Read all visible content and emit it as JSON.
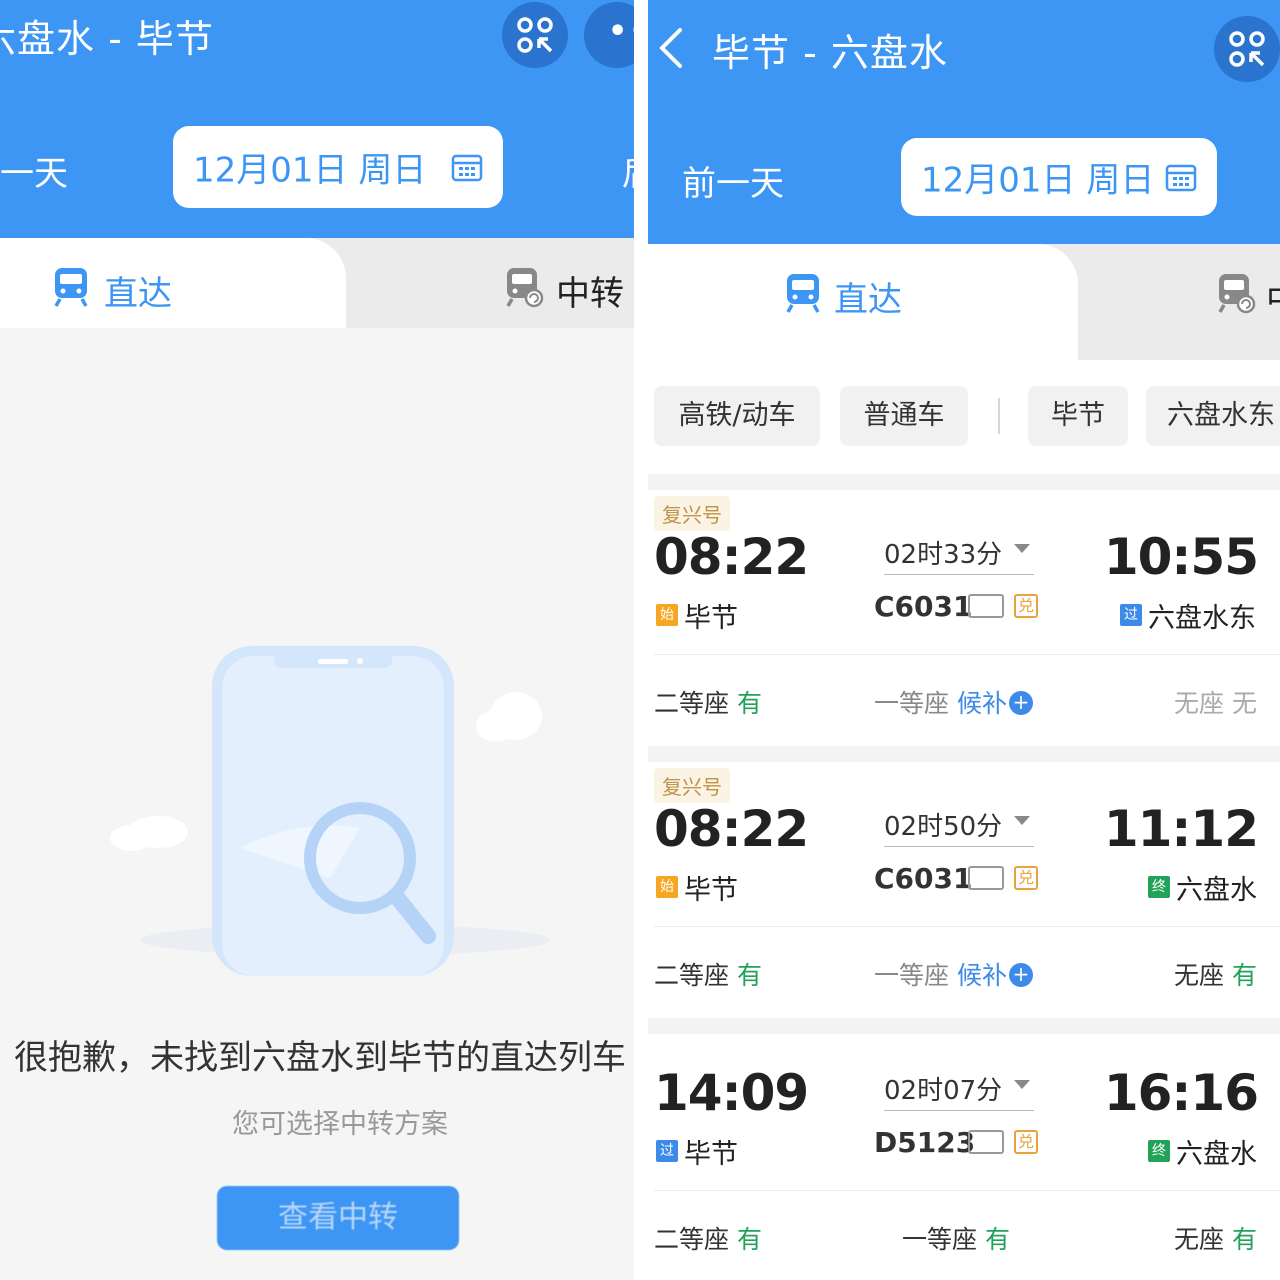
{
  "left": {
    "header_title": "六盘水 - 毕节",
    "prev_day": "前一天",
    "next_day": "后一天",
    "date": "12月01日  周日",
    "tab_direct": "直达",
    "tab_transfer": "中转",
    "empty_message": "很抱歉，未找到六盘水到毕节的直达列车",
    "empty_sub": "您可选择中转方案",
    "empty_button": "查看中转"
  },
  "right": {
    "header_title": "毕节 - 六盘水",
    "prev_day": "前一天",
    "date": "12月01日  周日",
    "tab_direct": "直达",
    "tab_transfer": "中转",
    "filters": [
      "高铁/动车",
      "普通车",
      "毕节",
      "六盘水东"
    ],
    "trains": [
      {
        "tag": "复兴号",
        "dep_time": "08:22",
        "duration": "02时33分",
        "train_no": "C6031",
        "dui": "兑",
        "arr_time": "10:55",
        "from_badge": "始",
        "from": "毕节",
        "to_badge": "过",
        "to": "六盘水东",
        "seats": [
          {
            "name": "二等座",
            "status": "有"
          },
          {
            "name": "一等座",
            "status": "候补"
          },
          {
            "name": "无座",
            "status": "无"
          }
        ]
      },
      {
        "tag": "复兴号",
        "dep_time": "08:22",
        "duration": "02时50分",
        "train_no": "C6031",
        "dui": "兑",
        "arr_time": "11:12",
        "from_badge": "始",
        "from": "毕节",
        "to_badge": "终",
        "to": "六盘水",
        "seats": [
          {
            "name": "二等座",
            "status": "有"
          },
          {
            "name": "一等座",
            "status": "候补"
          },
          {
            "name": "无座",
            "status": "有"
          }
        ]
      },
      {
        "tag": "",
        "dep_time": "14:09",
        "duration": "02时07分",
        "train_no": "D5123",
        "dui": "兑",
        "arr_time": "16:16",
        "from_badge": "过",
        "from": "毕节",
        "to_badge": "终",
        "to": "六盘水",
        "seats": [
          {
            "name": "二等座",
            "status": "有"
          },
          {
            "name": "一等座",
            "status": "有"
          },
          {
            "name": "无座",
            "status": "有"
          }
        ]
      }
    ]
  },
  "colors": {
    "header_blue": "#3d96f3",
    "available_green": "#23a35a",
    "waitlist_blue": "#3d8ae8",
    "origin_orange": "#f5a623",
    "pass_blue": "#3d8ae8",
    "terminal_green": "#23a35a"
  },
  "icons": {
    "app_button": "share-grid-icon",
    "more": "more-dots-icon",
    "calendar": "calendar-icon",
    "train": "train-icon",
    "transfer_train": "transfer-train-icon",
    "back": "back-chevron-icon",
    "id_card": "id-card-icon",
    "waitlist_add": "plus-circle-icon"
  }
}
